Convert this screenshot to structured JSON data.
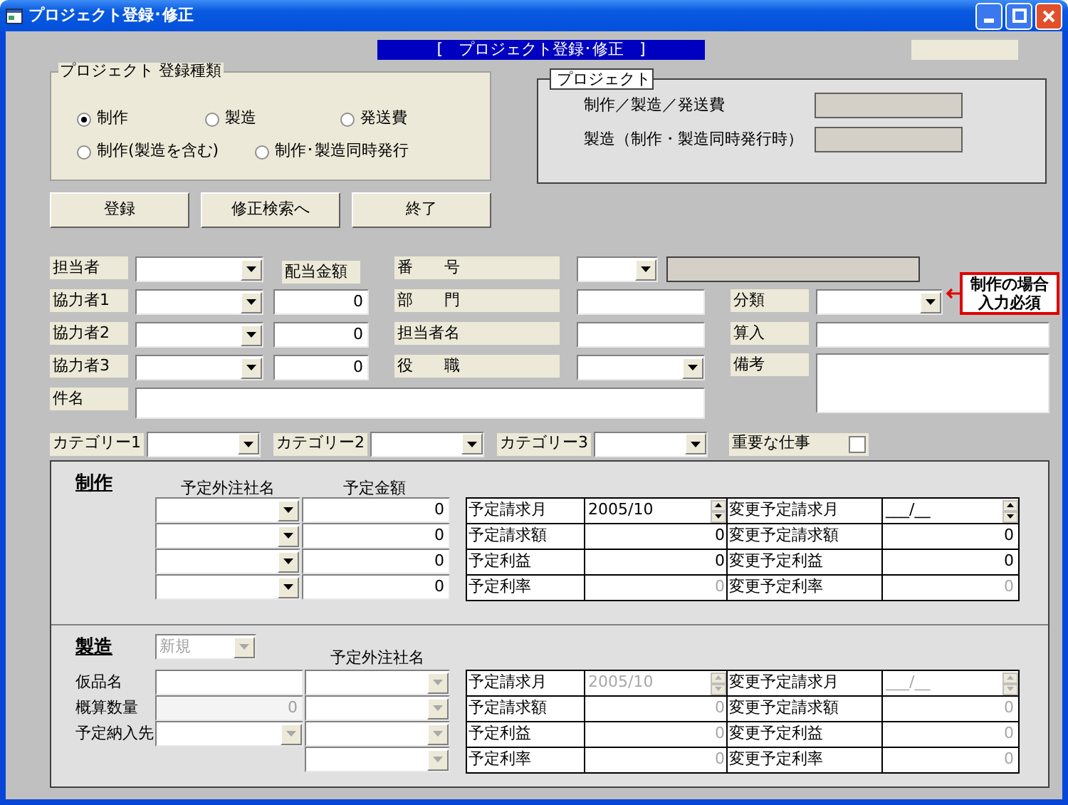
{
  "window": {
    "title": "プロジェクト登録･修正"
  },
  "banner": "[　プロジェクト登録･修正　]",
  "registration_type": {
    "legend": "プロジェクト 登録種類",
    "rows": [
      {
        "options": [
          {
            "label": "制作",
            "selected": true
          },
          {
            "label": "製造",
            "selected": false
          },
          {
            "label": "発送費",
            "selected": false
          }
        ]
      },
      {
        "options": [
          {
            "label": "制作(製造を含む)",
            "selected": false
          },
          {
            "label": "制作･製造同時発行",
            "selected": false
          }
        ]
      }
    ]
  },
  "project": {
    "legend": "プロジェクト",
    "fields": [
      {
        "label": "制作／製造／発送費"
      },
      {
        "label": "製造（制作・製造同時発行時）"
      }
    ]
  },
  "buttons": [
    "登録",
    "修正検索へ",
    "終了"
  ],
  "staff_label": "担当者",
  "allocation_label": "配当金額",
  "collaborators": [
    {
      "label": "協力者1",
      "amount": "0"
    },
    {
      "label": "協力者2",
      "amount": "0"
    },
    {
      "label": "協力者3",
      "amount": "0"
    }
  ],
  "number_label": "番　　号",
  "department_label": "部　　門",
  "person_label": "担当者名",
  "position_label": "役　　職",
  "classification": {
    "label": "分類",
    "note": [
      "制作の場合",
      "入力必須"
    ]
  },
  "inclusion_label": "算入",
  "remarks_label": "備考",
  "subject_label": "件名",
  "categories": [
    "カテゴリー1",
    "カテゴリー2",
    "カテゴリー3"
  ],
  "important": {
    "label": "重要な仕事",
    "checked": false
  },
  "production": {
    "heading": "制作",
    "columns": [
      "予定外注社名",
      "予定金額"
    ],
    "rows": [
      {
        "amount": "0"
      },
      {
        "amount": "0"
      },
      {
        "amount": "0"
      },
      {
        "amount": "0"
      }
    ],
    "summary": [
      {
        "kind": "spinner",
        "label": "予定請求月",
        "value": "2005/10",
        "change_label": "変更予定請求月",
        "change_value": "___/__",
        "disabled": false
      },
      {
        "kind": "number",
        "label": "予定請求額",
        "value": "0",
        "change_label": "変更予定請求額",
        "change_value": "0",
        "disabled": false
      },
      {
        "kind": "number",
        "label": "予定利益",
        "value": "0",
        "change_label": "変更予定利益",
        "change_value": "0",
        "disabled": false
      },
      {
        "kind": "number",
        "label": "予定利率",
        "value": "0",
        "change_label": "変更予定利率",
        "change_value": "0",
        "disabled": true
      }
    ]
  },
  "manufacturing": {
    "heading": "製造",
    "type_combo": {
      "value": "新規",
      "disabled": true
    },
    "column": "予定外注社名",
    "rows": [
      {
        "kind": "text",
        "label": "仮品名",
        "disabled": false,
        "vendor_disabled": true
      },
      {
        "kind": "number",
        "label": "概算数量",
        "value": "0",
        "disabled": true,
        "vendor_disabled": true
      },
      {
        "kind": "combo",
        "label": "予定納入先",
        "disabled": true,
        "vendor_disabled": true
      },
      {
        "kind": "none",
        "vendor_disabled": true
      }
    ],
    "summary": [
      {
        "kind": "spinner",
        "label": "予定請求月",
        "value": "2005/10",
        "change_label": "変更予定請求月",
        "change_value": "___/__",
        "disabled": true
      },
      {
        "kind": "number",
        "label": "予定請求額",
        "value": "0",
        "change_label": "変更予定請求額",
        "change_value": "0",
        "disabled": true
      },
      {
        "kind": "number",
        "label": "予定利益",
        "value": "0",
        "change_label": "変更予定利益",
        "change_value": "0",
        "disabled": true
      },
      {
        "kind": "number",
        "label": "予定利率",
        "value": "0",
        "change_label": "変更予定利率",
        "change_value": "0",
        "disabled": true
      }
    ]
  }
}
